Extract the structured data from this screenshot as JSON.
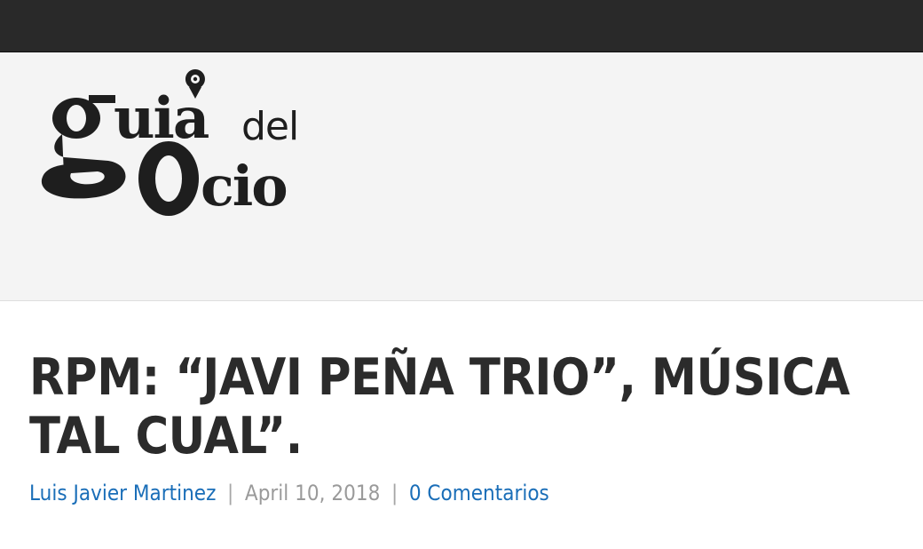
{
  "site": {
    "logo_text": "guia del ocio",
    "logo_line1": "guia",
    "logo_small": "del",
    "logo_line2": "ocio"
  },
  "article": {
    "title": "RPM: “JAVI PEÑA TRIO”, MÚSICA TAL CUAL”.",
    "author": "Luis Javier Martinez",
    "date": "April 10, 2018",
    "comments": "0 Comentarios",
    "separator": "|"
  },
  "colors": {
    "top_bar": "#292929",
    "header_bg": "#f4f4f4",
    "title": "#2b2b2b",
    "link": "#1a6eb8",
    "muted": "#9a9a9a"
  }
}
